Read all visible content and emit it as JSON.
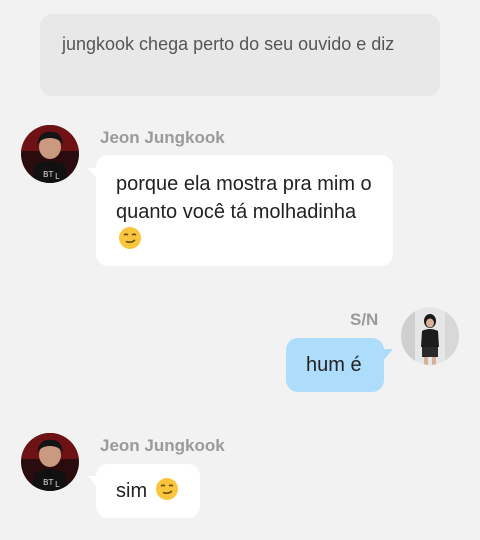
{
  "narration": "jungkook chega perto do seu ouvido e diz",
  "messages": [
    {
      "sender": "Jeon Jungkook",
      "side": "left",
      "text": "porque ela mostra pra mim o quanto você tá molhadinha",
      "emoji": "smirking-face-icon"
    },
    {
      "sender": "S/N",
      "side": "right",
      "text": "hum é"
    },
    {
      "sender": "Jeon Jungkook",
      "side": "left",
      "text": "sim",
      "emoji": "smirking-face-icon"
    }
  ],
  "colors": {
    "background": "#f2f2f2",
    "narration_bg": "#e8e8e8",
    "left_bubble": "#ffffff",
    "right_bubble": "#aedcfb",
    "name_text": "#9a9a9a"
  }
}
